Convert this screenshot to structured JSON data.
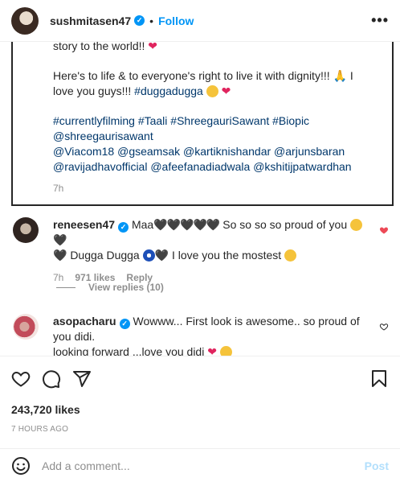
{
  "header": {
    "username": "sushmitasen47",
    "verified_mark": "✓",
    "separator": "•",
    "follow_label": "Follow",
    "more_label": "•••"
  },
  "caption": {
    "line1": "story to the world!! ",
    "line2": "Here's to life & to everyone's right to live it with dignity!!! ",
    "line2_end": " I",
    "line3": "love you guys!!! ",
    "line3_tag": "#duggadugga",
    "line4": "#currentlyfilming #Taali #ShreegauriSawant #Biopic",
    "line5": "@shreegaurisawant",
    "line6": "@Viacom18 @gseamsak @kartiknishandar @arjunsbaran",
    "line7": "@ravijadhavofficial @afeefanadiadwala @kshitijpatwardhan",
    "time": "7h",
    "emoji_heart": "❤",
    "emoji_pray": "🙏"
  },
  "comments": [
    {
      "username": "reneesen47",
      "text1": " Maa",
      "hearts": "🖤🖤🖤🖤🖤",
      "text1b": " So so so so proud of you ",
      "line2_a": "🖤 Dugga Dugga ",
      "line2_b": " I love you the mostest ",
      "time": "7h",
      "likes": "971 likes",
      "reply_label": "Reply"
    },
    {
      "username": "asopacharu",
      "text1": " Wowww... First look is awesome.. so proud of",
      "line2": "you didi.",
      "line3": "looking forward ...love you didi "
    }
  ],
  "view_replies": "View replies (10)",
  "likes_count": "243,720 likes",
  "time_ago": "7 HOURS AGO",
  "add_comment": {
    "placeholder": "Add a comment...",
    "post_label": "Post"
  },
  "colors": {
    "accent": "#0095f6",
    "like_red": "#ed4956",
    "post_disabled": "#b2dffc"
  }
}
